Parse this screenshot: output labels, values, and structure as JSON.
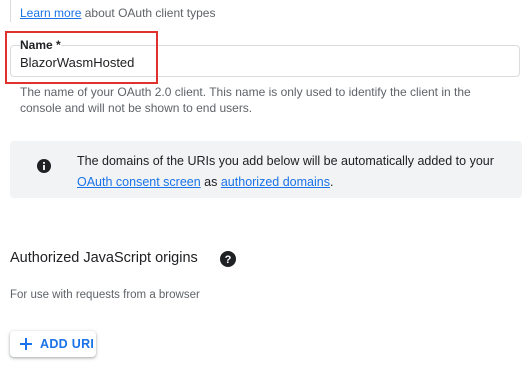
{
  "learn_more": {
    "link": "Learn more",
    "suffix": "about OAuth client types"
  },
  "name_field": {
    "label": "Name *",
    "value": "BlazorWasmHosted",
    "hint": "The name of your OAuth 2.0 client. This name is only used to identify the client in the console and will not be shown to end users."
  },
  "info": {
    "text_before": "The domains of the URIs you add below will be automatically added to your",
    "link1": "OAuth consent screen",
    "text_middle": "as",
    "link2": "authorized domains",
    "text_after": ".",
    "icon": "info-icon"
  },
  "js_origins": {
    "title": "Authorized JavaScript origins",
    "help_icon": "help-icon",
    "description": "For use with requests from a browser",
    "add_button": "ADD URI"
  },
  "colors": {
    "link": "#1a73e8",
    "highlight": "#e0312c",
    "info_bg": "#f1f3f4"
  }
}
